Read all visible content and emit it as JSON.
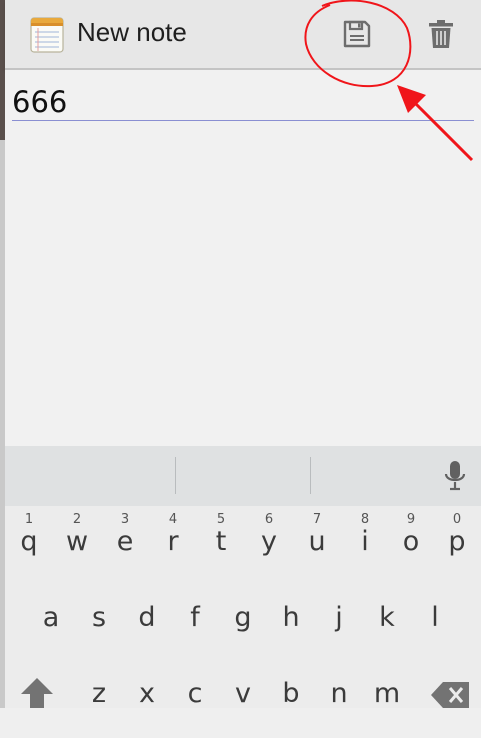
{
  "app_bar": {
    "title": "New note",
    "icon": "notepad-icon",
    "actions": [
      {
        "name": "save",
        "icon": "floppy-disk-icon"
      },
      {
        "name": "delete",
        "icon": "trash-icon"
      }
    ]
  },
  "note": {
    "text": "666"
  },
  "keyboard": {
    "row1": [
      {
        "key": "q",
        "hint": "1"
      },
      {
        "key": "w",
        "hint": "2"
      },
      {
        "key": "e",
        "hint": "3"
      },
      {
        "key": "r",
        "hint": "4"
      },
      {
        "key": "t",
        "hint": "5"
      },
      {
        "key": "y",
        "hint": "6"
      },
      {
        "key": "u",
        "hint": "7"
      },
      {
        "key": "i",
        "hint": "8"
      },
      {
        "key": "o",
        "hint": "9"
      },
      {
        "key": "p",
        "hint": "0"
      }
    ],
    "row2": [
      "a",
      "s",
      "d",
      "f",
      "g",
      "h",
      "j",
      "k",
      "l"
    ],
    "row3": [
      "z",
      "x",
      "c",
      "v",
      "b",
      "n",
      "m"
    ],
    "shift_icon": "shift-arrow-icon",
    "backspace_icon": "backspace-icon",
    "mic_icon": "microphone-icon"
  },
  "annotation": {
    "color": "#f0151a",
    "shapes": [
      "circle-around-save",
      "arrow-to-save"
    ]
  }
}
